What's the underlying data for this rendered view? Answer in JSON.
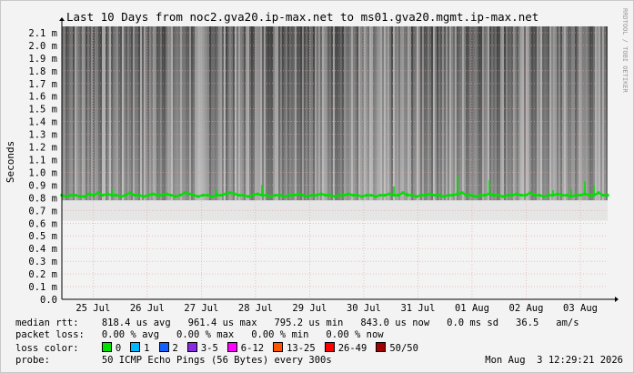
{
  "chart_data": {
    "type": "line",
    "title": "Last 10 Days from noc2.gva20.ip-max.net to ms01.gva20.mgmt.ip-max.net",
    "ylabel": "Seconds",
    "ylabel_unit_suffix": "m",
    "ylim": [
      0,
      2.15
    ],
    "y_ticks": [
      "0.0",
      "0.1 m",
      "0.2 m",
      "0.3 m",
      "0.4 m",
      "0.5 m",
      "0.6 m",
      "0.7 m",
      "0.8 m",
      "0.9 m",
      "1.0 m",
      "1.1 m",
      "1.2 m",
      "1.3 m",
      "1.4 m",
      "1.5 m",
      "1.6 m",
      "1.7 m",
      "1.8 m",
      "1.9 m",
      "2.0 m",
      "2.1 m"
    ],
    "x_ticks": [
      "25 Jul",
      "26 Jul",
      "27 Jul",
      "28 Jul",
      "29 Jul",
      "30 Jul",
      "31 Jul",
      "01 Aug",
      "02 Aug",
      "03 Aug"
    ],
    "x_range": [
      "24 Jul",
      "03 Aug"
    ],
    "watermark": "RRDTOOL / TOBI OETIKER",
    "grid": true,
    "series": [
      {
        "name": "median rtt",
        "color": "#00e000",
        "x": [
          0,
          0.5,
          1,
          1.5,
          2,
          2.5,
          3,
          3.5,
          4,
          4.5,
          5,
          5.5,
          6,
          6.5,
          7,
          7.5,
          8,
          8.5,
          9,
          9.5,
          10,
          10.5,
          11,
          11.5,
          12,
          12.5,
          13,
          13.5,
          14,
          14.5,
          15,
          15.5,
          16,
          16.5,
          17,
          17.5,
          18,
          18.5,
          19,
          19.5,
          20,
          20.5,
          21,
          21.5,
          22,
          22.5,
          23,
          23.5,
          24,
          24.5,
          25,
          25.5,
          26,
          26.5,
          27,
          27.5,
          28,
          28.5,
          29,
          29.5,
          30,
          30.5,
          31,
          31.5,
          32,
          32.5,
          33,
          33.5,
          34,
          34.5,
          35,
          35.5,
          36,
          36.5,
          37,
          37.5,
          38,
          38.5,
          39,
          39.5,
          40,
          40.5,
          41,
          41.5,
          42,
          42.5,
          43,
          43.5,
          44,
          44.5,
          45,
          45.5,
          46,
          46.5,
          47,
          47.5,
          48,
          48.5,
          49,
          49.5,
          50,
          50.5,
          51,
          51.5,
          52,
          52.5,
          53,
          53.5,
          54,
          54.5,
          55,
          55.5,
          56,
          56.5,
          57,
          57.5,
          58,
          58.5,
          59,
          59.5,
          60
        ],
        "y": [
          0.82,
          0.81,
          0.82,
          0.82,
          0.81,
          0.81,
          0.83,
          0.82,
          0.84,
          0.82,
          0.83,
          0.82,
          0.82,
          0.81,
          0.82,
          0.84,
          0.82,
          0.82,
          0.81,
          0.82,
          0.83,
          0.82,
          0.82,
          0.83,
          0.82,
          0.81,
          0.82,
          0.84,
          0.83,
          0.82,
          0.81,
          0.82,
          0.82,
          0.81,
          0.82,
          0.82,
          0.83,
          0.84,
          0.83,
          0.82,
          0.82,
          0.81,
          0.82,
          0.83,
          0.82,
          0.82,
          0.81,
          0.82,
          0.82,
          0.81,
          0.82,
          0.82,
          0.83,
          0.82,
          0.81,
          0.82,
          0.82,
          0.83,
          0.82,
          0.82,
          0.81,
          0.82,
          0.82,
          0.83,
          0.82,
          0.82,
          0.81,
          0.82,
          0.82,
          0.81,
          0.82,
          0.82,
          0.83,
          0.82,
          0.82,
          0.84,
          0.82,
          0.82,
          0.81,
          0.82,
          0.82,
          0.83,
          0.82,
          0.82,
          0.81,
          0.82,
          0.82,
          0.83,
          0.84,
          0.82,
          0.82,
          0.81,
          0.82,
          0.82,
          0.83,
          0.82,
          0.82,
          0.81,
          0.82,
          0.82,
          0.83,
          0.82,
          0.82,
          0.84,
          0.82,
          0.82,
          0.81,
          0.82,
          0.82,
          0.83,
          0.82,
          0.82,
          0.81,
          0.82,
          0.82,
          0.83,
          0.82,
          0.82,
          0.84,
          0.82,
          0.82
        ],
        "spikes_x": [
          5.5,
          17,
          22,
          36.5,
          38,
          43.5,
          47,
          54,
          56,
          57.5,
          58.5
        ],
        "spikes_y": [
          0.87,
          0.86,
          0.9,
          0.89,
          0.84,
          0.97,
          0.94,
          0.86,
          0.87,
          0.93,
          0.9
        ]
      }
    ]
  },
  "stats": {
    "median_label": "median rtt:",
    "median_values": "818.4 us avg   961.4 us max   795.2 us min   843.0 us now   0.0 ms sd   36.5   am/s",
    "loss_label": "packet loss:",
    "loss_values": "0.00 % avg   0.00 % max   0.00 % min   0.00 % now",
    "color_label": "loss color:",
    "loss_colors": [
      {
        "label": "0",
        "color": "#00e000"
      },
      {
        "label": "1",
        "color": "#00b8ff"
      },
      {
        "label": "2",
        "color": "#1060ff"
      },
      {
        "label": "3-5",
        "color": "#8a2be2"
      },
      {
        "label": "6-12",
        "color": "#ff00ff"
      },
      {
        "label": "13-25",
        "color": "#ff5500"
      },
      {
        "label": "26-49",
        "color": "#ff0000"
      },
      {
        "label": "50/50",
        "color": "#a00000"
      }
    ],
    "probe_label": "probe:",
    "probe_value": "50 ICMP Echo Pings (56 Bytes) every 300s",
    "timestamp": "Mon Aug  3 12:29:21 2026"
  }
}
